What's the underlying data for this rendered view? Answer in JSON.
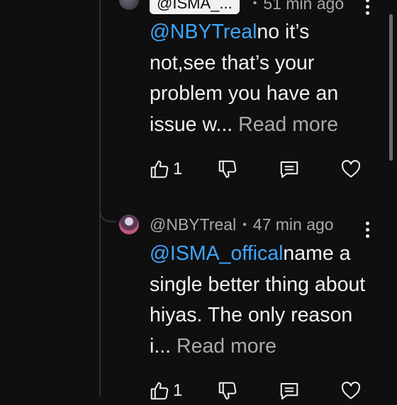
{
  "comments": [
    {
      "author": "@ISMA_...",
      "time": "51 min ago",
      "mention": "@NBYTreal",
      "text": "no it’s not,see that’s your problem you have an issue w...",
      "read_more": "Read more",
      "like_count": "1"
    },
    {
      "author": "@NBYTreal",
      "time": "47 min ago",
      "mention": "@ISMA_offical",
      "text": "name a single better thing about hiyas. The only reason i...",
      "read_more": "Read more",
      "like_count": "1"
    }
  ],
  "icons": [
    "thumbs-up-icon",
    "thumbs-down-icon",
    "reply-icon",
    "heart-icon",
    "more-vert-icon"
  ],
  "colors": {
    "background": "#0f0f0f",
    "text": "#f1f1f1",
    "muted": "#aaaaaa",
    "mention": "#3ea6ff"
  }
}
